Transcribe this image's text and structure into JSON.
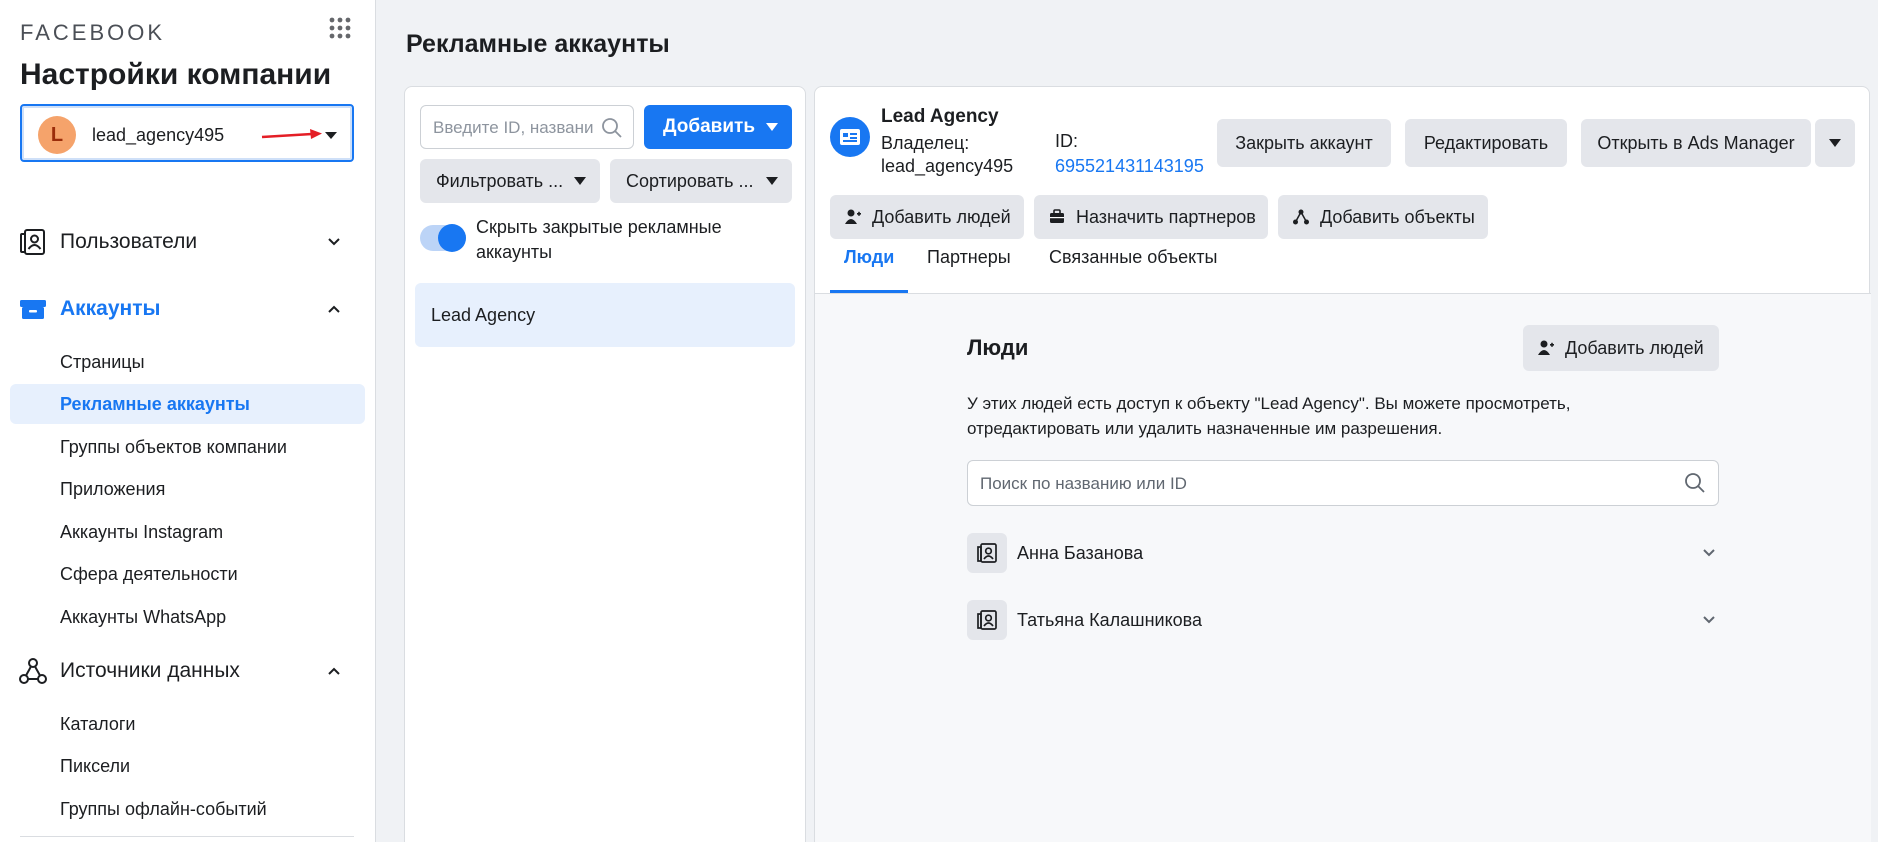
{
  "sidebar": {
    "logo": "FACEBOOK",
    "title": "Настройки компании",
    "account": {
      "initial": "L",
      "name": "lead_agency495"
    },
    "sections": [
      {
        "label": "Пользователи",
        "expanded": false,
        "icon": "users-icon"
      },
      {
        "label": "Аккаунты",
        "expanded": true,
        "icon": "accounts-icon",
        "items": [
          "Страницы",
          "Рекламные аккаунты",
          "Группы объектов компании",
          "Приложения",
          "Аккаунты Instagram",
          "Сфера деятельности",
          "Аккаунты WhatsApp"
        ],
        "selected": "Рекламные аккаунты"
      },
      {
        "label": "Источники данных",
        "expanded": true,
        "icon": "data-sources-icon",
        "items": [
          "Каталоги",
          "Пиксели",
          "Группы офлайн-событий"
        ]
      }
    ]
  },
  "page": {
    "title": "Рекламные аккаунты"
  },
  "list": {
    "search_placeholder": "Введите ID, название или...",
    "add_label": "Добавить",
    "filter_label": "Фильтровать ...",
    "sort_label": "Сортировать ...",
    "toggle_label": "Скрыть закрытые рекламные аккаунты",
    "toggle_on": true,
    "items": [
      "Lead Agency"
    ]
  },
  "detail": {
    "name": "Lead Agency",
    "owner_label": "Владелец:",
    "owner_value": "lead_agency495",
    "id_label": "ID:",
    "id_value": "695521431143195",
    "header_buttons": [
      "Закрыть аккаунт",
      "Редактировать",
      "Открыть в Ads Manager"
    ],
    "actions": [
      "Добавить людей",
      "Назначить партнеров",
      "Добавить объекты"
    ],
    "tabs": [
      "Люди",
      "Партнеры",
      "Связанные объекты"
    ],
    "active_tab": "Люди",
    "people": {
      "title": "Люди",
      "add_label": "Добавить людей",
      "description": "У этих людей есть доступ к объекту \"Lead Agency\". Вы можете просмотреть, отредактировать или удалить назначенные им разрешения.",
      "search_placeholder": "Поиск по названию или ID",
      "rows": [
        "Анна Базанова",
        "Татьяна Калашникова"
      ]
    }
  },
  "colors": {
    "accent": "#1877f2",
    "annotation_arrow": "#e41e26"
  }
}
